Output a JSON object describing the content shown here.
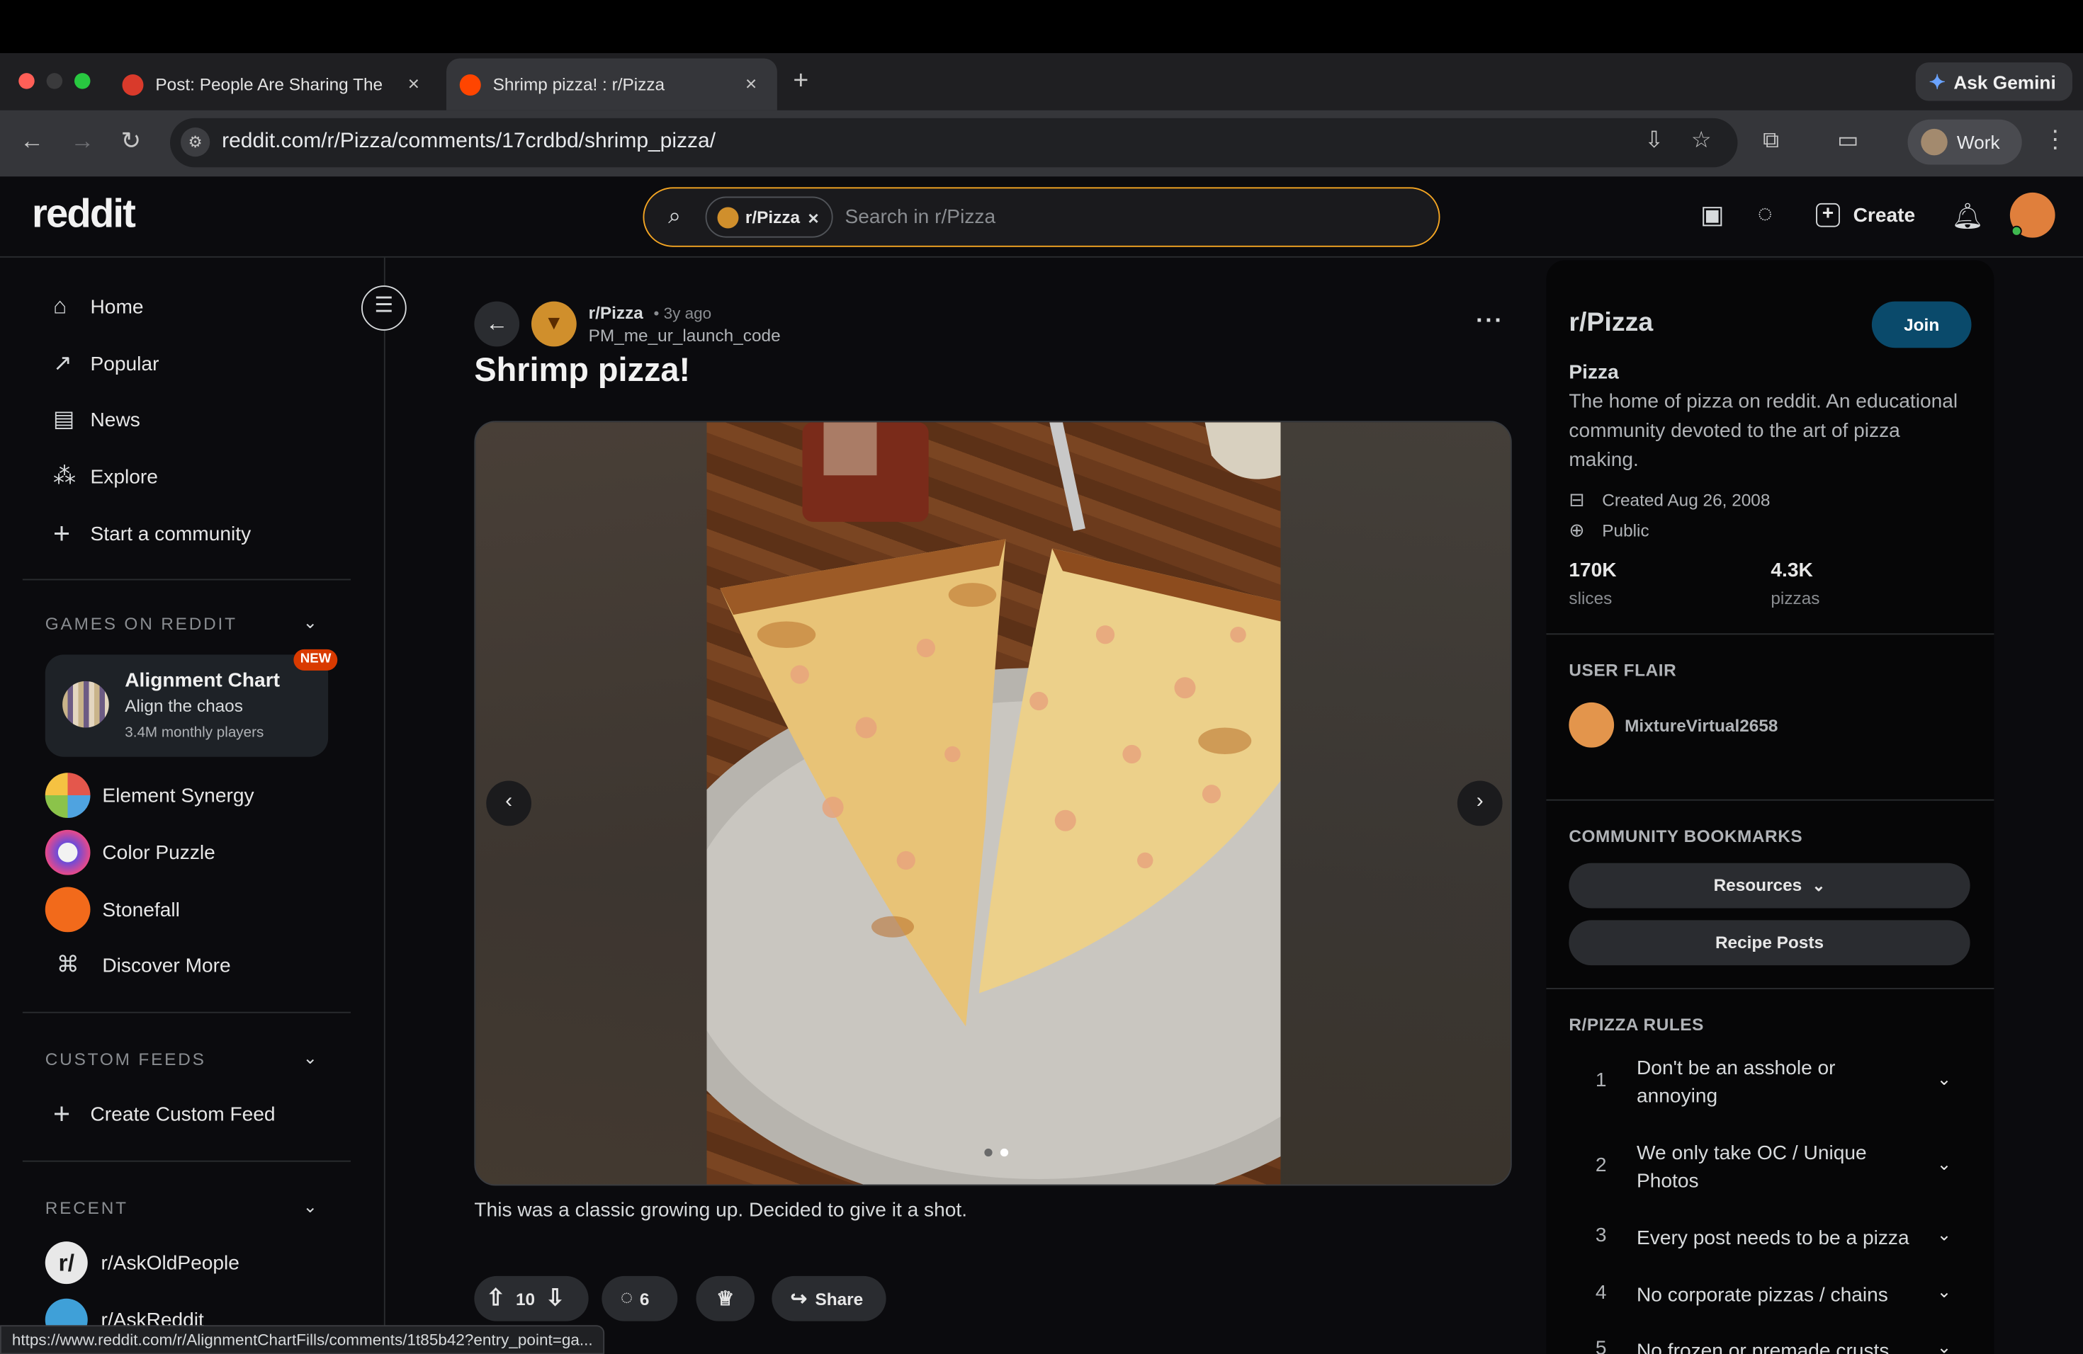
{
  "browser": {
    "tabs": [
      {
        "title": "Post: People Are Sharing The"
      },
      {
        "title": "Shrimp pizza! : r/Pizza"
      }
    ],
    "new_tab": "+",
    "ask_gemini": "Ask Gemini",
    "url": "reddit.com/r/Pizza/comments/17crdbd/shrimp_pizza/",
    "profile": "Work",
    "status_url": "https://www.reddit.com/r/AlignmentChartFills/comments/1t85b42?entry_point=ga..."
  },
  "header": {
    "logo": "reddit",
    "search_chip": "r/Pizza",
    "search_placeholder": "Search in r/Pizza",
    "create_label": "Create"
  },
  "sidebar": {
    "nav": [
      {
        "label": "Home",
        "icon": "home-icon"
      },
      {
        "label": "Popular",
        "icon": "popular-icon"
      },
      {
        "label": "News",
        "icon": "news-icon"
      },
      {
        "label": "Explore",
        "icon": "explore-icon"
      },
      {
        "label": "Start a community",
        "icon": "plus-icon"
      }
    ],
    "games_header": "GAMES ON REDDIT",
    "featured_game": {
      "title": "Alignment Chart",
      "subtitle": "Align the chaos",
      "players": "3.4M monthly players",
      "badge": "NEW"
    },
    "games": [
      "Element Synergy",
      "Color Puzzle",
      "Stonefall",
      "Discover More"
    ],
    "custom_feeds_header": "CUSTOM FEEDS",
    "create_feed": "Create Custom Feed",
    "recent_header": "RECENT",
    "recent": [
      "r/AskOldPeople",
      "r/AskReddit"
    ]
  },
  "post": {
    "subreddit": "r/Pizza",
    "time": "• 3y ago",
    "author": "PM_me_ur_launch_code",
    "title": "Shrimp pizza!",
    "body": "This was a classic growing up. Decided to give it a shot.",
    "gallery_total": 2,
    "gallery_current": 2,
    "votes": "10",
    "comments": "6",
    "share": "Share"
  },
  "community": {
    "name": "r/Pizza",
    "join": "Join",
    "title": "Pizza",
    "description": "The home of pizza on reddit. An educational community devoted to the art of pizza making.",
    "created": "Created Aug 26, 2008",
    "visibility": "Public",
    "members_value": "170K",
    "members_label": "slices",
    "online_value": "4.3K",
    "online_label": "pizzas",
    "user_flair_header": "USER FLAIR",
    "flair_user": "MixtureVirtual2658",
    "bookmarks_header": "COMMUNITY BOOKMARKS",
    "bookmarks": [
      "Resources",
      "Recipe Posts"
    ],
    "rules_header": "R/PIZZA RULES",
    "rules": [
      {
        "n": "1",
        "text": "Don't be an asshole or annoying"
      },
      {
        "n": "2",
        "text": "We only take OC / Unique Photos"
      },
      {
        "n": "3",
        "text": "Every post needs to be a pizza"
      },
      {
        "n": "4",
        "text": "No corporate pizzas / chains"
      },
      {
        "n": "5",
        "text": "No frozen or premade crusts"
      }
    ]
  },
  "colors": {
    "accent_search": "#f5a623",
    "join_button": "#0a4a6b",
    "new_badge": "#d93a00",
    "background": "#0b0b0e"
  }
}
